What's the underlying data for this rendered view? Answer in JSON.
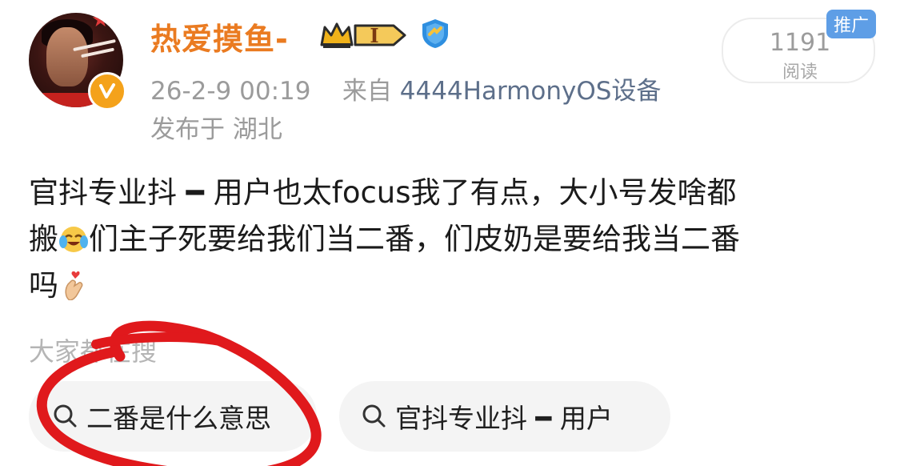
{
  "post": {
    "author": {
      "name": "热爱摸鱼-",
      "level_badge": "I"
    },
    "timestamp": "26-2-9 00:19",
    "source_prefix": "来自",
    "source": "4444HarmonyOS设备",
    "location": "发布于 湖北",
    "read_count": "1191",
    "read_label": "阅读",
    "promo_label": "推广",
    "content": {
      "line1": "官抖专业抖 ━ 用户也太focus我了有点，大小号发啥都",
      "line2_a": "搬",
      "line2_b": "们主子死要给我们当二番，们皮奶是要给我当二番",
      "line3": "吗"
    }
  },
  "related": {
    "heading": "大家都在搜",
    "items": [
      {
        "label": "二番是什么意思"
      },
      {
        "label": "官抖专业抖 ━ 用户"
      }
    ]
  },
  "colors": {
    "username": "#ea7b21",
    "source_link": "#5d6f8a",
    "promo": "#5e9ee6",
    "annotation": "#e0191c"
  },
  "icons": {
    "crown": "crown-icon",
    "verify": "verified-shield-icon",
    "search": "search-icon"
  }
}
